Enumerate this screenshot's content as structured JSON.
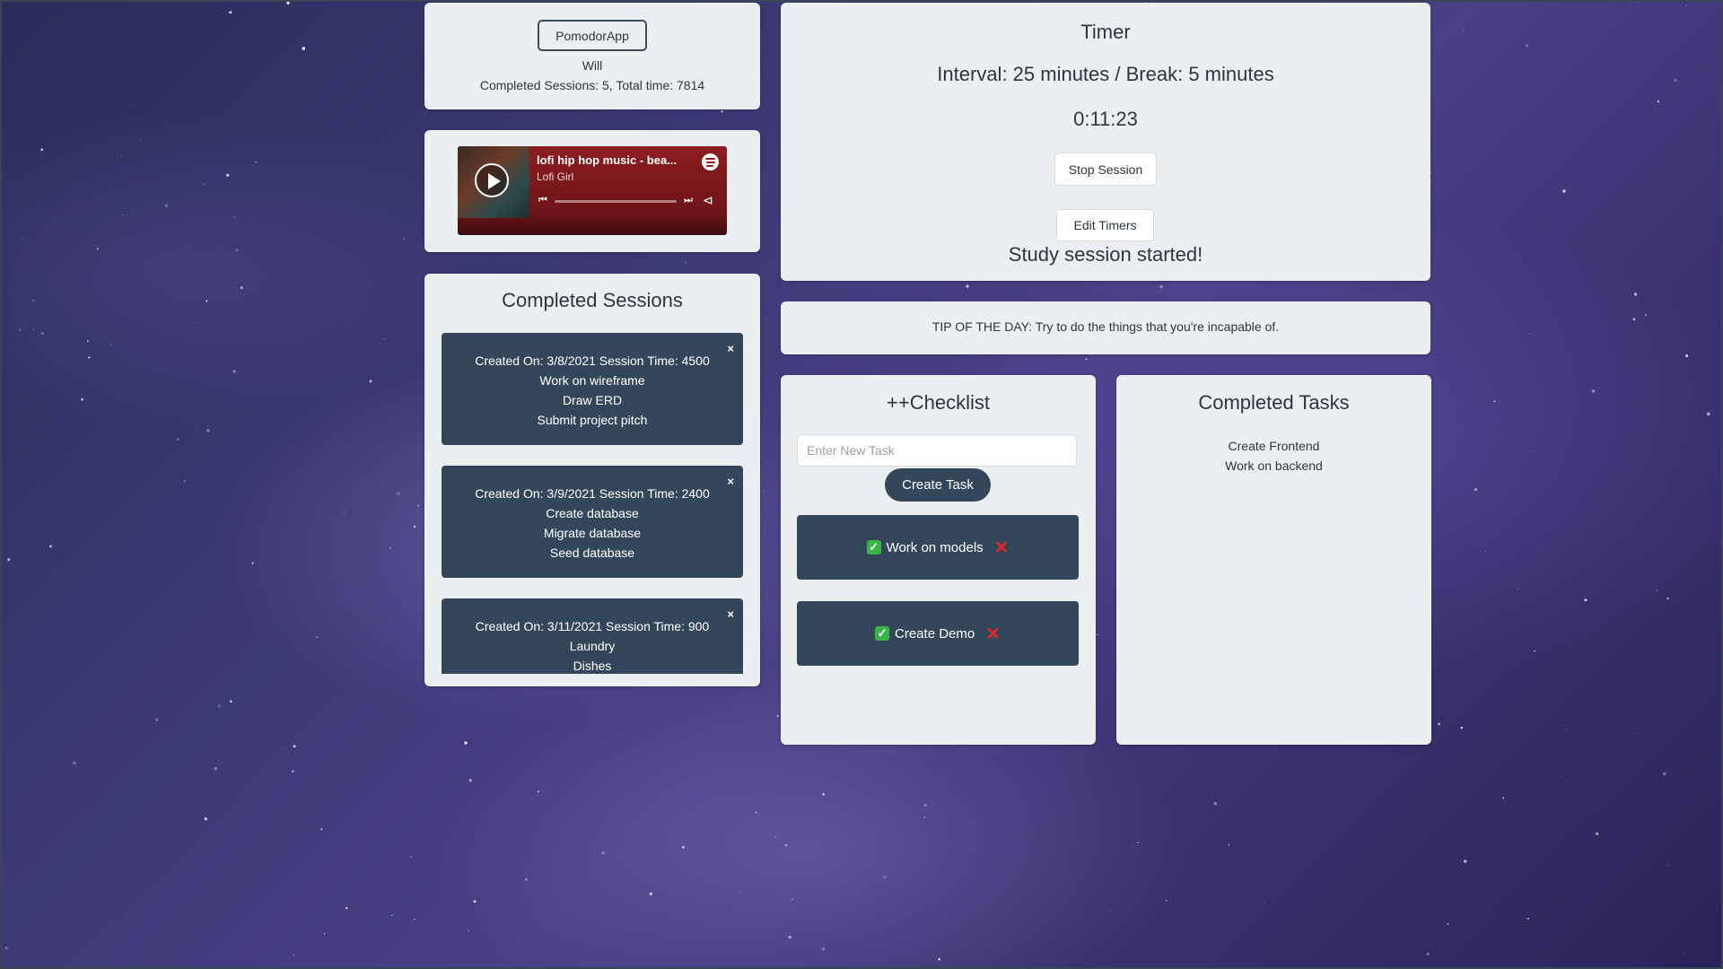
{
  "profile": {
    "app_button": "PomodorApp",
    "username": "Will",
    "stats": "Completed Sessions: 5, Total time: 7814"
  },
  "music": {
    "title": "lofi hip hop music - bea...",
    "artist": "Lofi Girl",
    "icons": [
      "play-icon",
      "spotify-icon",
      "previous-icon",
      "next-icon",
      "share-icon"
    ]
  },
  "sessions": {
    "heading": "Completed Sessions",
    "items": [
      {
        "header": "Created On: 3/8/2021 Session Time: 4500",
        "tasks": [
          "Work on wireframe",
          "Draw ERD",
          "Submit project pitch"
        ]
      },
      {
        "header": "Created On: 3/9/2021 Session Time: 2400",
        "tasks": [
          "Create database",
          "Migrate database",
          "Seed database"
        ]
      },
      {
        "header": "Created On: 3/11/2021 Session Time: 900",
        "tasks": [
          "Laundry",
          "Dishes",
          ""
        ]
      }
    ],
    "close_glyph": "×"
  },
  "timer": {
    "heading": "Timer",
    "interval": "Interval: 25 minutes / Break: 5 minutes",
    "countdown": "0:11:23",
    "stop_label": "Stop Session",
    "edit_label": "Edit Timers",
    "status": "Study session started!"
  },
  "tip": "TIP OF THE DAY: Try to do the things that you're incapable of.",
  "checklist": {
    "heading": "++Checklist",
    "input_placeholder": "Enter New Task",
    "create_label": "Create Task",
    "tasks": [
      "Work on models",
      "Create Demo"
    ]
  },
  "completed_tasks": {
    "heading": "Completed Tasks",
    "items": [
      "Create Frontend",
      "Work on backend"
    ]
  },
  "colors": {
    "card_bg": "#eceff1",
    "dark_tile": "#34475a",
    "spotify_red": "#8c1d21",
    "check_green": "#3ab34a",
    "delete_red": "#e0262b"
  }
}
